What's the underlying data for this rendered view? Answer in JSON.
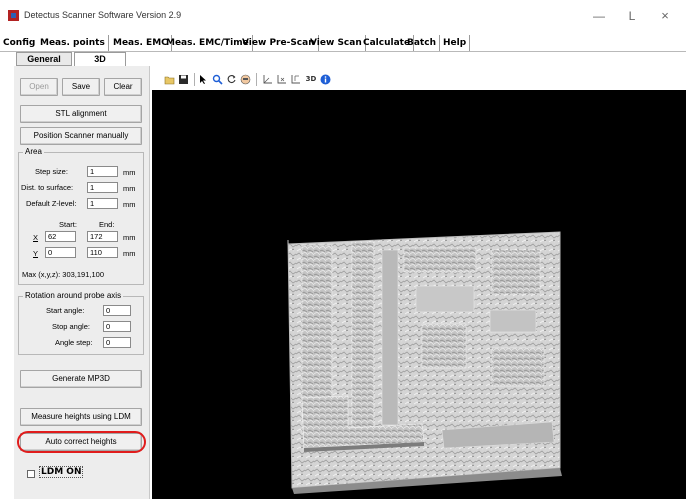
{
  "window": {
    "title": "Detectus Scanner Software Version 2.9",
    "minimize_glyph": "—",
    "maximize_glyph": "L",
    "close_glyph": "×"
  },
  "menu": [
    "Config",
    "Meas. points",
    "Meas. EMC",
    "Meas. EMC/Time",
    "View Pre-Scan",
    "View Scan",
    "Calculate",
    "Batch",
    "Help"
  ],
  "subtabs": {
    "general": "General",
    "threed": "3D"
  },
  "panel": {
    "open_label": "Open",
    "save_label": "Save",
    "clear_label": "Clear",
    "stl_label": "STL alignment",
    "position_label": "Position Scanner manually",
    "area": {
      "title": "Area",
      "step_size_label": "Step size:",
      "step_size": "1",
      "dist_label": "Dist. to surface:",
      "dist": "1",
      "zlevel_label": "Default Z-level:",
      "zlevel": "1",
      "unit": "mm",
      "start_label": "Start:",
      "end_label": "End:",
      "x_label": "X",
      "x_start": "62",
      "x_end": "172",
      "y_label": "Y",
      "y_start": "0",
      "y_end": "110",
      "max_text": "Max (x,y,z): 303,191,100"
    },
    "rotation": {
      "title": "Rotation around probe axis",
      "start_label": "Start angle:",
      "start": "0",
      "stop_label": "Stop angle:",
      "stop": "0",
      "step_label": "Angle step:",
      "step": "0"
    },
    "generate_label": "Generate MP3D",
    "measure_label": "Measure heights using LDM",
    "auto_label": "Auto correct heights",
    "ldm_label": "LDM ON"
  },
  "toolbar": {
    "icons": [
      "open-file-icon",
      "save-icon",
      "pointer-icon",
      "zoom-icon",
      "rotate-icon",
      "pan-icon",
      "axis-xy-icon",
      "axis-xz-icon",
      "axis-yz-icon",
      "view-3d-icon",
      "info-icon"
    ],
    "view3d_label": "3D",
    "info_glyph": "i"
  },
  "viewport": {
    "background": "#000000",
    "surface_color": "#d9d9d9"
  },
  "colors": {
    "highlight": "#e01c1c",
    "info_blue": "#1f5fd6"
  }
}
